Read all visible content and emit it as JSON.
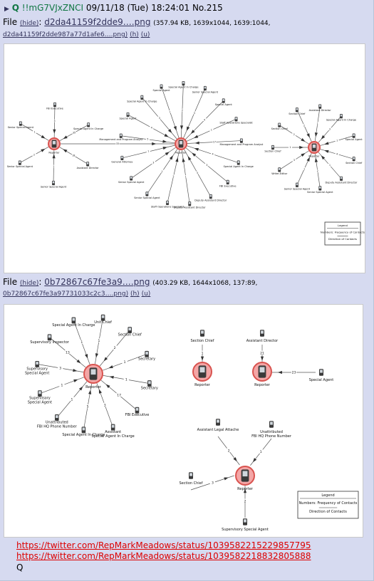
{
  "post": {
    "arrow": "▶",
    "name": "Q",
    "tripcode": "!!mG7VJxZNCI",
    "datetime": "09/11/18 (Tue) 18:24:01",
    "number": "No.215"
  },
  "files": [
    {
      "label": "File",
      "hide": "(hide)",
      "filename": "d2da41159f2dde9….png",
      "meta": "(357.94 KB, 1639x1044, 1639:1044,",
      "fullname": "d2da41159f2dde987a77d1afe6….png)",
      "h": "(h)",
      "u": "(u)"
    },
    {
      "label": "File",
      "hide": "(hide)",
      "filename": "0b72867c67fe3a9….png",
      "meta": "(403.29 KB, 1644x1068, 137:89,",
      "fullname": "0b72867c67fe3a97731033c2c3….png)",
      "h": "(h)",
      "u": "(u)"
    }
  ],
  "image1": {
    "left": {
      "center": "Reporter",
      "nodes": [
        "Senior Special Agent",
        "FBI Executive",
        "Special Agent In Charge",
        "Assistant Director",
        "Senior Special Agent",
        "Senior Special Agent"
      ],
      "counts": [
        "1",
        "5",
        "35",
        "18",
        "1",
        "2"
      ]
    },
    "middle": {
      "center": "Reporter",
      "nodes": [
        "Special Agent",
        "Special Agent In Charge",
        "Senior Special Agent",
        "Special Agent",
        "Staff Operations Specialist",
        "Management and Program Analyst",
        "Special Agent In Charge",
        "FBI Executive",
        "Deputy Assistant Director",
        "Deputy Assistant Director",
        "Staff Operations Specialist",
        "Senior Special Agent",
        "Senior Special Agent",
        "General Attorney",
        "Management and Program Analyst",
        "Special Agent",
        "Special Agent In Charge"
      ],
      "counts": [
        "1",
        "2",
        "3",
        "4",
        "1",
        "17",
        "4",
        "3",
        "5",
        "1",
        "2",
        "1",
        "3",
        "7",
        "5",
        "4",
        "3"
      ]
    },
    "right": {
      "center": "Reporter",
      "nodes": [
        "Section Chief",
        "Assistant Director",
        "Special Agent In Charge",
        "Special Agent",
        "Section Chief",
        "Deputy Assistant Director",
        "Senior Special Agent",
        "Senior Special Agent",
        "Writer-Editor",
        "Section Chief",
        "Section Chief"
      ],
      "counts": [
        "2",
        "1",
        "3",
        "1",
        "4",
        "1",
        "2",
        "1",
        "3",
        "1",
        "2"
      ]
    },
    "legend": {
      "title": "Legend",
      "numbers": "Numbers: Frequency of Contacts",
      "direction": "Direction of Contacts"
    }
  },
  "image2": {
    "main": {
      "center": "Reporter",
      "nodes": [
        {
          "label": "Unit Chief",
          "count": "1"
        },
        {
          "label": "Section Chief",
          "count": "2"
        },
        {
          "label": "Secretary",
          "count": "1"
        },
        {
          "label": "Secretary",
          "count": "1"
        },
        {
          "label": "FBI Executive",
          "count": "17"
        },
        {
          "label": "Assistant Special Agent In Charge",
          "count": "3"
        },
        {
          "label": "Special Agent In Charge",
          "count": "5"
        },
        {
          "label": "Unattributed FBI HQ Phone Number",
          "count": "1"
        },
        {
          "label": "Supervisory Special Agent",
          "count": "1"
        },
        {
          "label": "Supervisory Special Agent",
          "count": "3"
        },
        {
          "label": "Supervisory Inspector",
          "count": "13"
        },
        {
          "label": "Special Agent In Charge",
          "count": "1"
        }
      ]
    },
    "g2": {
      "center": "Reporter",
      "node": "Section Chief",
      "count": "1"
    },
    "g3": {
      "center": "Reporter",
      "node": "Assistant Director",
      "count": "21",
      "node2": "Special Agent",
      "count2": "23"
    },
    "g4": {
      "center": "Reporter",
      "nodes": [
        {
          "label": "Assistant Legal Attache",
          "count": "2"
        },
        {
          "label": "Unattributed FBI HQ Phone Number",
          "count": "1"
        },
        {
          "label": "Section Chief",
          "count": "3"
        },
        {
          "label": "Supervisory Special Agent",
          "count": "2"
        }
      ]
    },
    "legend": {
      "title": "Legend",
      "numbers": "Numbers: Frequency of Contacts",
      "direction": "Direction of Contacts"
    }
  },
  "links": [
    "https://twitter.com/RepMarkMeadows/status/1039582215229857795",
    "https://twitter.com/RepMarkMeadows/status/1039582218832805888"
  ],
  "signature": "Q"
}
